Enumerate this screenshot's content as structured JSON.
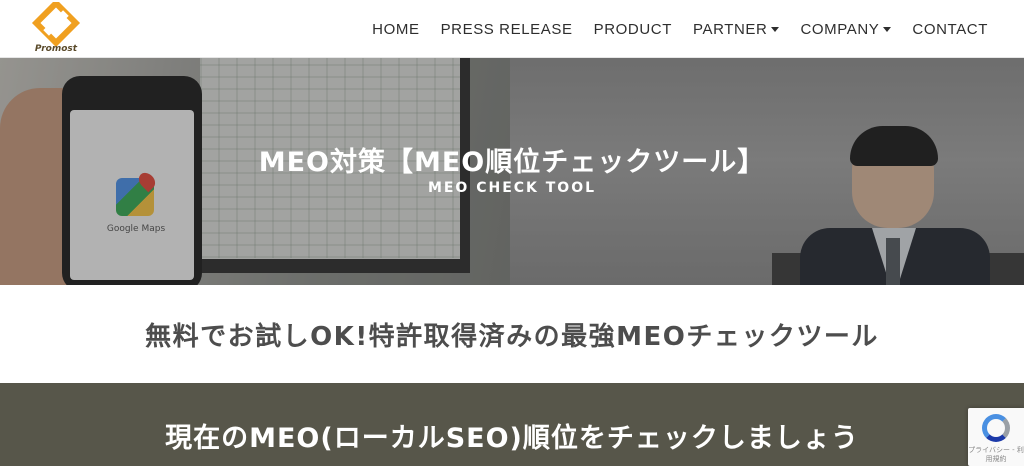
{
  "brand": {
    "name": "Promost"
  },
  "nav": {
    "items": [
      {
        "label": "HOME",
        "dropdown": false
      },
      {
        "label": "PRESS RELEASE",
        "dropdown": false
      },
      {
        "label": "PRODUCT",
        "dropdown": false
      },
      {
        "label": "PARTNER",
        "dropdown": true
      },
      {
        "label": "COMPANY",
        "dropdown": true
      },
      {
        "label": "CONTACT",
        "dropdown": false
      }
    ]
  },
  "hero": {
    "title": "MEO対策【MEO順位チェックツール】",
    "subtitle": "MEO CHECK TOOL",
    "phone_app_label": "Google Maps"
  },
  "tagline": "無料でお試しOK!特許取得済みの最強MEOチェックツール",
  "band": {
    "heading": "現在のMEO(ローカルSEO)順位をチェックしましょう"
  },
  "recaptcha": {
    "text": "プライバシー - 利用規約"
  },
  "colors": {
    "header_bg": "#ffffff",
    "band_bg": "#57564a",
    "logo_orange": "#f0a020",
    "nav_text": "#2e2e2e"
  }
}
